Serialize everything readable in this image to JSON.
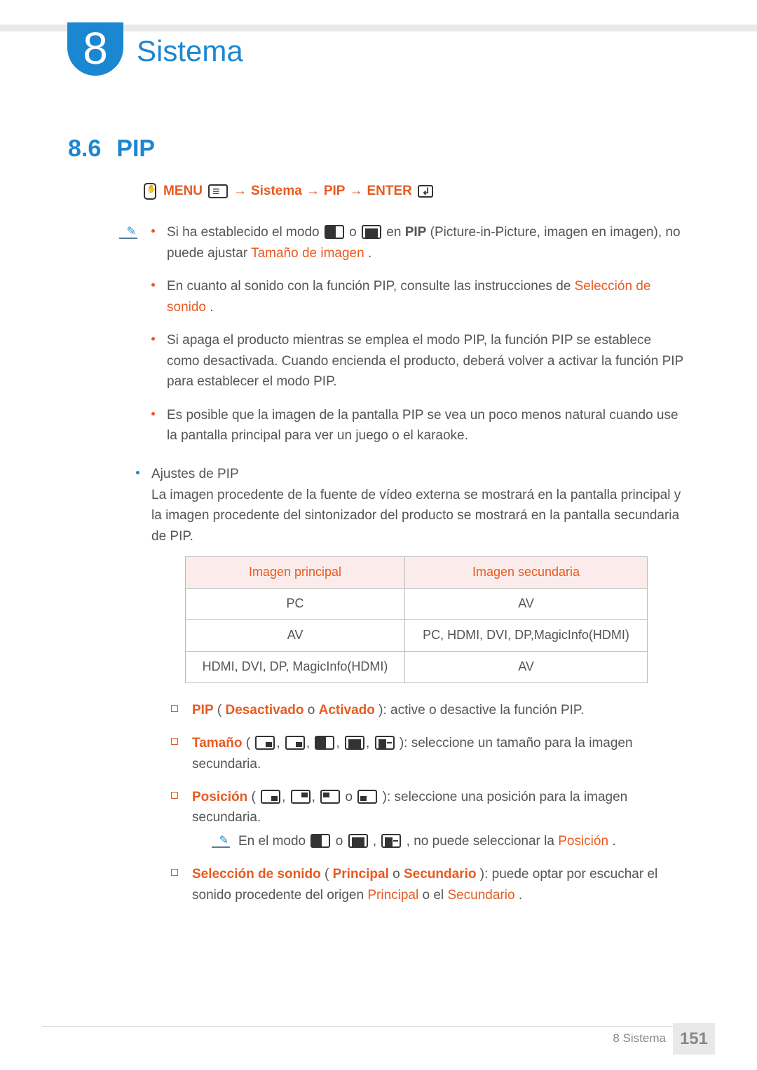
{
  "chapter": {
    "number": "8",
    "title": "Sistema"
  },
  "section": {
    "number": "8.6",
    "title": "PIP"
  },
  "nav": {
    "menu": "MENU",
    "s1": "Sistema",
    "s2": "PIP",
    "enter": "ENTER"
  },
  "notes": {
    "n1_a": "Si ha establecido el modo ",
    "n1_b": " o ",
    "n1_c": " en ",
    "n1_pip": "PIP",
    "n1_d": " (Picture-in-Picture, imagen en imagen), no puede ajustar ",
    "n1_e": "Tamaño de imagen",
    "n1_f": ".",
    "n2_a": "En cuanto al sonido con la función PIP, consulte las instrucciones de ",
    "n2_b": "Selección de sonido",
    "n2_c": ".",
    "n3": "Si apaga el producto mientras se emplea el modo PIP, la función PIP se establece como desactivada. Cuando encienda el producto, deberá volver a activar la función PIP para establecer el modo PIP.",
    "n4": "Es posible que la imagen de la pantalla PIP se vea un poco menos natural cuando use la pantalla principal para ver un juego o el karaoke."
  },
  "settings": {
    "label": "Ajustes de PIP",
    "desc": "La imagen procedente de la fuente de vídeo externa se mostrará en la pantalla principal y la imagen procedente del sintonizador del producto se mostrará en la pantalla secundaria de PIP."
  },
  "table": {
    "h1": "Imagen principal",
    "h2": "Imagen secundaria",
    "rows": [
      [
        "PC",
        "AV"
      ],
      [
        "AV",
        "PC, HDMI, DVI, DP,MagicInfo(HDMI)"
      ],
      [
        "HDMI, DVI, DP, MagicInfo(HDMI)",
        "AV"
      ]
    ]
  },
  "opts": {
    "pip_label": "PIP",
    "pip_off": "Desactivado",
    "pip_or": " o ",
    "pip_on": "Activado",
    "pip_desc": "): active o desactive la función PIP.",
    "size_label": "Tamaño",
    "size_desc": "): seleccione un tamaño para la imagen secundaria.",
    "pos_label": "Posición",
    "pos_or": " o ",
    "pos_desc": "): seleccione una posición para la imagen secundaria.",
    "subnote_a": "En el modo ",
    "subnote_b": " o ",
    "subnote_c": ", ",
    "subnote_d": ", no puede seleccionar la ",
    "subnote_e": "Posición",
    "subnote_f": ".",
    "snd_label": "Selección de sonido",
    "snd_p": "Principal",
    "snd_or": " o ",
    "snd_s": "Secundario",
    "snd_desc_a": "): puede optar por escuchar el sonido procedente del origen ",
    "snd_desc_b": " o el ",
    "snd_desc_c": "."
  },
  "footer": {
    "label": "8 Sistema",
    "page": "151"
  }
}
